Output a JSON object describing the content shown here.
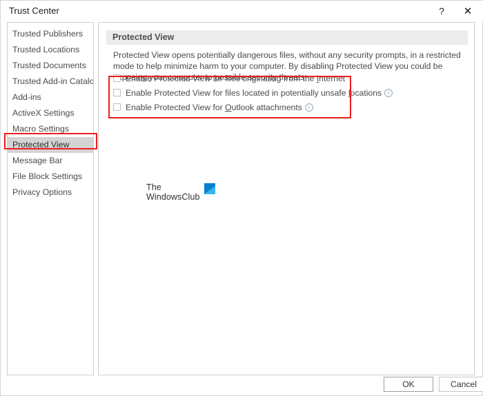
{
  "window": {
    "title": "Trust Center",
    "help_label": "?",
    "close_label": "✕"
  },
  "sidebar": {
    "items": [
      {
        "label": "Trusted Publishers",
        "selected": false
      },
      {
        "label": "Trusted Locations",
        "selected": false
      },
      {
        "label": "Trusted Documents",
        "selected": false
      },
      {
        "label": "Trusted Add-in Catalogs",
        "selected": false
      },
      {
        "label": "Add-ins",
        "selected": false
      },
      {
        "label": "ActiveX Settings",
        "selected": false
      },
      {
        "label": "Macro Settings",
        "selected": false
      },
      {
        "label": "Protected View",
        "selected": true
      },
      {
        "label": "Message Bar",
        "selected": false
      },
      {
        "label": "File Block Settings",
        "selected": false
      },
      {
        "label": "Privacy Options",
        "selected": false
      }
    ]
  },
  "content": {
    "section_title": "Protected View",
    "description": "Protected View opens potentially dangerous files, without any security prompts, in a restricted mode to help minimize harm to your computer. By disabling Protected View you could be exposing your computer to possible security threats.",
    "checkboxes": [
      {
        "label_before": "Enable Protected View for files originating from the ",
        "accel": "I",
        "label_after": "nternet",
        "checked": false,
        "has_info": false
      },
      {
        "label_before": "Enable Protected View for files located in potentially unsafe ",
        "accel": "l",
        "label_after": "ocations",
        "checked": false,
        "has_info": true
      },
      {
        "label_before": "Enable Protected View for ",
        "accel": "O",
        "label_after": "utlook attachments",
        "checked": false,
        "has_info": true
      }
    ],
    "info_glyph": "i"
  },
  "watermark": {
    "line1": "The",
    "line2": "WindowsClub"
  },
  "footer": {
    "ok_label": "OK",
    "cancel_label": "Cancel"
  },
  "colors": {
    "annotation_red": "#ee1b1b",
    "selection_gray": "#d4d4d4",
    "header_gray": "#ececec",
    "logo_blue": "#0a7ed1"
  }
}
